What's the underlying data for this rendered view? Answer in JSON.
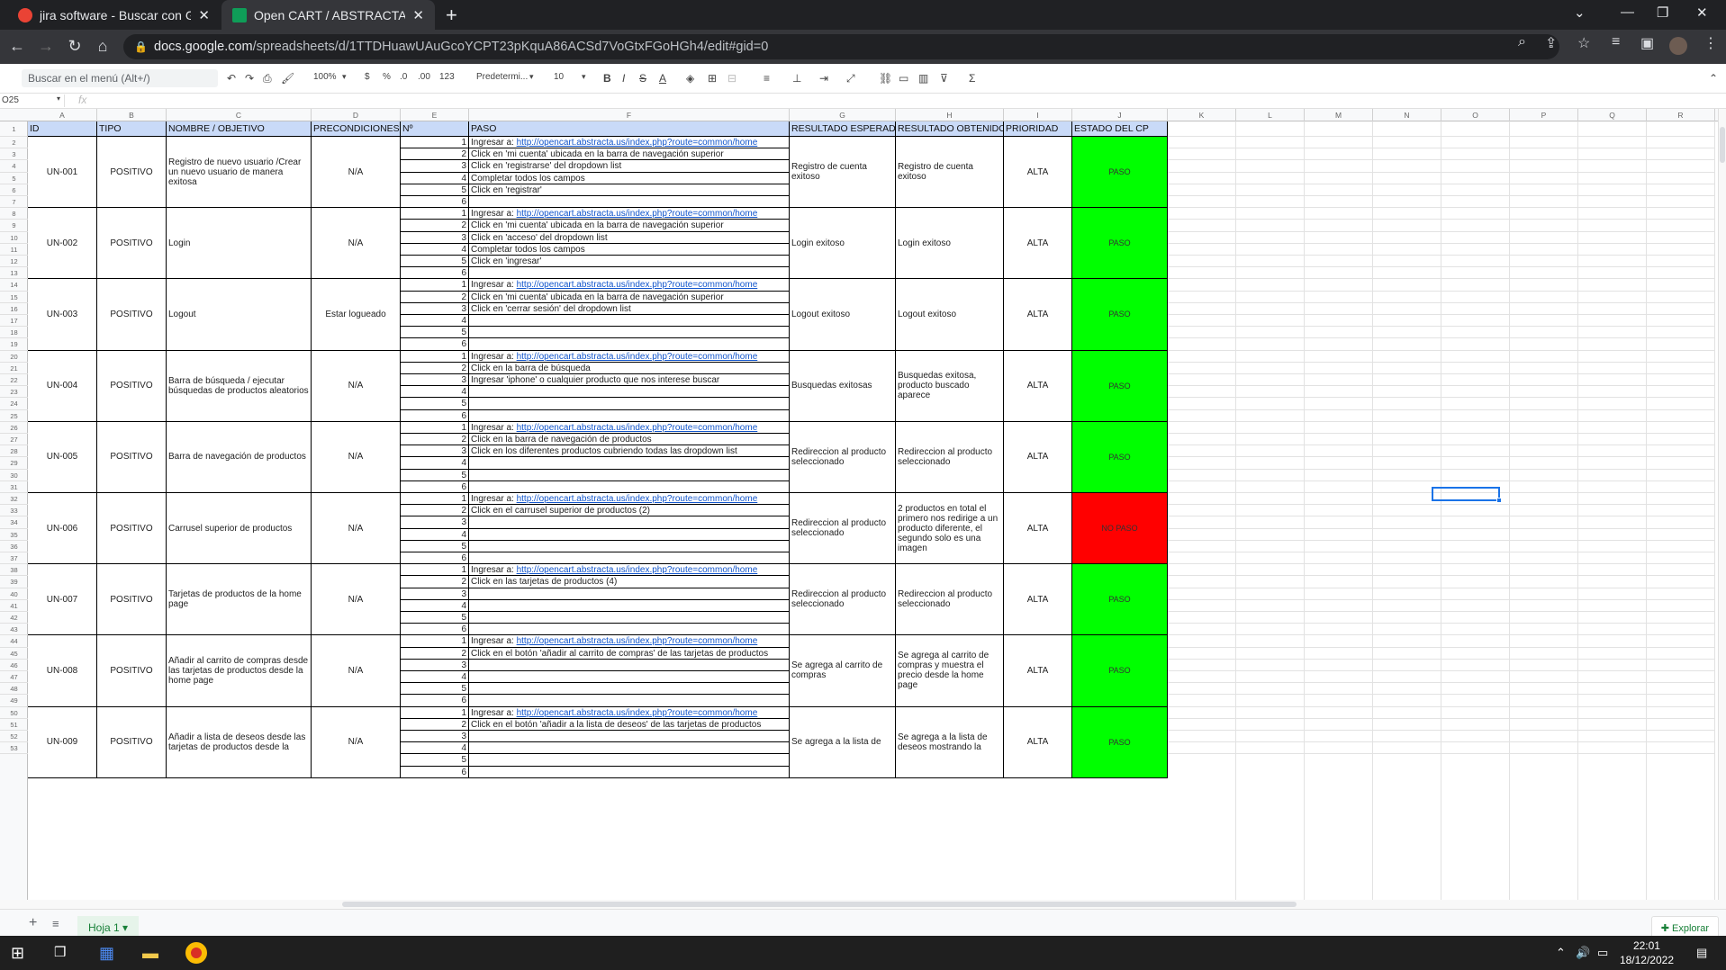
{
  "browser": {
    "tabs": [
      {
        "title": "jira software - Buscar con Google",
        "active": false,
        "favicon_color": "#ea4335"
      },
      {
        "title": "Open CART / ABSTRACTA - Hoja",
        "active": true,
        "favicon_color": "#0f9d58"
      }
    ],
    "url_host": "docs.google.com",
    "url_path": "/spreadsheets/d/1TTDHuawUAuGcoYCPT23pKquA86ACSd7VoGtxFGoHGh4/edit#gid=0"
  },
  "toolbar": {
    "menu_search_placeholder": "Buscar en el menú (Alt+/)",
    "zoom": "100%",
    "currency": "$",
    "percent": "%",
    "dec_less": ".0",
    "dec_more": ".00",
    "format_more": "123",
    "font": "Predetermi...",
    "font_size": "10"
  },
  "formula_bar": {
    "name_box": "O25",
    "fx": "fx"
  },
  "columns": [
    "A",
    "B",
    "C",
    "D",
    "E",
    "F",
    "G",
    "H",
    "I",
    "J",
    "K",
    "L",
    "M",
    "N",
    "O",
    "P",
    "Q",
    "R"
  ],
  "header_row": [
    "ID",
    "TIPO",
    "NOMBRE / OBJETIVO",
    "PRECONDICIONES",
    "Nº",
    "PASO",
    "RESULTADO ESPERADO",
    "RESULTADO OBTENIDO",
    "PRIORIDAD",
    "ESTADO DEL CP"
  ],
  "test_cases": [
    {
      "id": "UN-001",
      "tipo": "POSITIVO",
      "nombre": "Registro de nuevo usuario /Crear un nuevo usuario de manera exitosa",
      "precondiciones": "N/A",
      "pasos": [
        "Ingresar a: |http://opencart.abstracta.us/index.php?route=common/home",
        "Click en 'mi cuenta' ubicada en la barra de navegación superior",
        "Click en 'registrarse' del dropdown list",
        "Completar todos los campos",
        "Click en 'registrar'",
        ""
      ],
      "esperado": "Registro de cuenta exitoso",
      "obtenido": "Registro de cuenta exitoso",
      "prioridad": "ALTA",
      "estado": "PASO"
    },
    {
      "id": "UN-002",
      "tipo": "POSITIVO",
      "nombre": "Login",
      "precondiciones": "N/A",
      "pasos": [
        "Ingresar a: |http://opencart.abstracta.us/index.php?route=common/home",
        "Click en 'mi cuenta' ubicada en la barra de navegación superior",
        "Click en 'acceso' del dropdown list",
        "Completar todos los campos",
        "Click en 'ingresar'",
        ""
      ],
      "esperado": "Login exitoso",
      "obtenido": "Login exitoso",
      "prioridad": "ALTA",
      "estado": "PASO"
    },
    {
      "id": "UN-003",
      "tipo": "POSITIVO",
      "nombre": "Logout",
      "precondiciones": "Estar logueado",
      "pasos": [
        "Ingresar a: |http://opencart.abstracta.us/index.php?route=common/home",
        "Click en 'mi cuenta' ubicada en la barra de navegación superior",
        "Click en 'cerrar sesión' del dropdown list",
        "",
        "",
        ""
      ],
      "esperado": "Logout exitoso",
      "obtenido": "Logout exitoso",
      "prioridad": "ALTA",
      "estado": "PASO"
    },
    {
      "id": "UN-004",
      "tipo": "POSITIVO",
      "nombre": "Barra de búsqueda / ejecutar búsquedas de productos aleatorios",
      "precondiciones": "N/A",
      "pasos": [
        "Ingresar a: |http://opencart.abstracta.us/index.php?route=common/home",
        "Click en la barra de búsqueda",
        "Ingresar 'iphone' o cualquier producto que nos interese buscar",
        "",
        "",
        ""
      ],
      "esperado": "Busquedas exitosas",
      "obtenido": "Busquedas exitosa, producto buscado aparece",
      "prioridad": "ALTA",
      "estado": "PASO"
    },
    {
      "id": "UN-005",
      "tipo": "POSITIVO",
      "nombre": "Barra de navegación de productos",
      "precondiciones": "N/A",
      "pasos": [
        "Ingresar a: |http://opencart.abstracta.us/index.php?route=common/home",
        "Click en la barra de navegación de productos",
        "Click en los diferentes productos cubriendo todas las dropdown list",
        "",
        "",
        ""
      ],
      "esperado": "Redireccion al producto seleccionado",
      "obtenido": "Redireccion al producto seleccionado",
      "prioridad": "ALTA",
      "estado": "PASO"
    },
    {
      "id": "UN-006",
      "tipo": "POSITIVO",
      "nombre": "Carrusel superior de productos",
      "precondiciones": "N/A",
      "pasos": [
        "Ingresar a: |http://opencart.abstracta.us/index.php?route=common/home",
        "Click en el carrusel superior de productos (2)",
        "",
        "",
        "",
        ""
      ],
      "esperado": "Redireccion al producto seleccionado",
      "obtenido": "2 productos en total el primero nos redirige a un producto diferente, el segundo solo es una imagen",
      "prioridad": "ALTA",
      "estado": "NO PASO"
    },
    {
      "id": "UN-007",
      "tipo": "POSITIVO",
      "nombre": "Tarjetas de productos de la home page",
      "precondiciones": "N/A",
      "pasos": [
        "Ingresar a: |http://opencart.abstracta.us/index.php?route=common/home",
        "Click en las tarjetas de productos (4)",
        "",
        "",
        "",
        ""
      ],
      "esperado": "Redireccion al producto seleccionado",
      "obtenido": "Redireccion al producto seleccionado",
      "prioridad": "ALTA",
      "estado": "PASO"
    },
    {
      "id": "UN-008",
      "tipo": "POSITIVO",
      "nombre": "Añadir al carrito de compras desde las tarjetas de productos desde la home page",
      "precondiciones": "N/A",
      "pasos": [
        "Ingresar a: |http://opencart.abstracta.us/index.php?route=common/home",
        "Click en el botón 'añadir al carrito de compras' de las tarjetas de productos",
        "",
        "",
        "",
        ""
      ],
      "esperado": "Se agrega al carrito de compras",
      "obtenido": "Se agrega al carrito de compras y muestra el precio desde la home page",
      "prioridad": "ALTA",
      "estado": "PASO"
    },
    {
      "id": "UN-009",
      "tipo": "POSITIVO",
      "nombre": "Añadir a lista de deseos desde las tarjetas de productos desde la",
      "precondiciones": "N/A",
      "pasos": [
        "Ingresar a: |http://opencart.abstracta.us/index.php?route=common/home",
        "Click en el botón 'añadir a la lista de deseos' de las tarjetas de productos",
        "",
        "",
        "",
        ""
      ],
      "esperado": "Se agrega a la lista de",
      "obtenido": "Se agrega a la lista de deseos mostrando la",
      "prioridad": "ALTA",
      "estado": "PASO"
    }
  ],
  "colors": {
    "pass": "#00ff00",
    "fail": "#ff0000",
    "header": "#c9daf8",
    "link": "#1155cc"
  },
  "sheet_tab": "Hoja 1",
  "explore_label": "Explorar",
  "taskbar": {
    "time": "22:01",
    "date": "18/12/2022"
  },
  "icons": [
    "windows-icon",
    "task-view-icon",
    "calculator-icon",
    "file-explorer-icon",
    "chrome-icon"
  ]
}
